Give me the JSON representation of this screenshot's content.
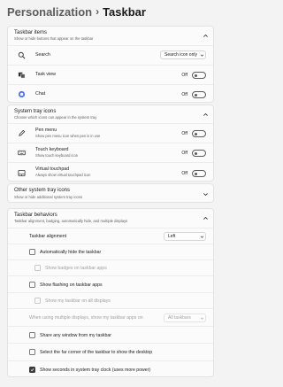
{
  "breadcrumb": {
    "parent": "Personalization",
    "separator": "›",
    "current": "Taskbar"
  },
  "taskbar_items": {
    "title": "Taskbar items",
    "subtitle": "Show or hide buttons that appear on the taskbar",
    "search": {
      "label": "Search",
      "value": "Search icon only",
      "icon": "search-icon"
    },
    "task_view": {
      "label": "Task view",
      "state": "Off",
      "icon": "task-view-icon"
    },
    "chat": {
      "label": "Chat",
      "state": "Off",
      "icon": "chat-icon"
    }
  },
  "system_tray_icons": {
    "title": "System tray icons",
    "subtitle": "Choose which icons can appear in the system tray",
    "pen_menu": {
      "label": "Pen menu",
      "sub": "Show pen menu icon when pen is in use",
      "state": "Off",
      "icon": "pen-icon"
    },
    "touch_keyboard": {
      "label": "Touch keyboard",
      "sub": "Show touch keyboard icon",
      "state": "Off",
      "icon": "keyboard-icon"
    },
    "virtual_touchpad": {
      "label": "Virtual touchpad",
      "sub": "Always show virtual touchpad icon",
      "state": "Off",
      "icon": "touchpad-icon"
    }
  },
  "other_tray_icons": {
    "title": "Other system tray icons",
    "subtitle": "Show or hide additional system tray icons"
  },
  "taskbar_behaviors": {
    "title": "Taskbar behaviors",
    "subtitle": "Taskbar alignment, badging, automatically hide, and multiple displays",
    "alignment": {
      "label": "Taskbar alignment",
      "value": "Left"
    },
    "auto_hide": {
      "label": "Automatically hide the taskbar",
      "checked": false
    },
    "badges": {
      "label": "Show badges on taskbar apps",
      "checked": false,
      "disabled": true
    },
    "flashing": {
      "label": "Show flashing on taskbar apps",
      "checked": false
    },
    "all_displays": {
      "label": "Show my taskbar on all displays",
      "checked": false,
      "disabled": true
    },
    "multiple_displays": {
      "label": "When using multiple displays, show my taskbar apps on",
      "value": "All taskbars",
      "disabled": true
    },
    "share_window": {
      "label": "Share any window from my taskbar",
      "checked": false
    },
    "far_corner": {
      "label": "Select the far corner of the taskbar to show the desktop",
      "checked": false
    },
    "seconds": {
      "label": "Show seconds in system tray clock (uses more power)",
      "checked": true
    }
  },
  "colors": {
    "background": "#f3f3f3",
    "card": "#fbfbfb",
    "border": "#e3e3e3",
    "checked": "#3a3a3a"
  }
}
